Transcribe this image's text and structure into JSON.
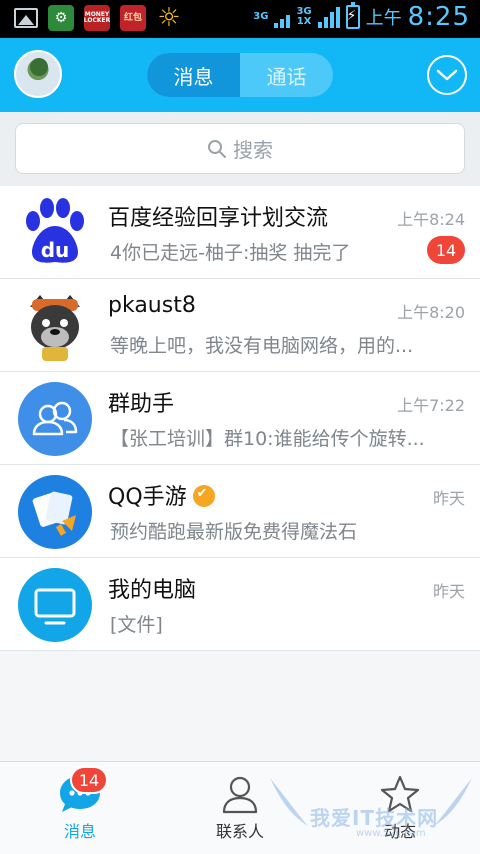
{
  "status_bar": {
    "notif_money": "MONEY LOCKER",
    "notif_hongbao": "红包",
    "net_top": "3G",
    "net_mid": "3G",
    "net_bottom": "1X",
    "ampm": "上午",
    "time": "8:25"
  },
  "header": {
    "tabs": [
      {
        "label": "消息",
        "active": true
      },
      {
        "label": "通话",
        "active": false
      }
    ],
    "dropdown_icon": "chevron-down-circle-icon"
  },
  "search": {
    "placeholder": "搜索"
  },
  "conversations": [
    {
      "title": "百度经验回享计划交流",
      "time": "上午8:24",
      "preview": "4你已走远-柚子:抽奖 抽完了",
      "unread": "14"
    },
    {
      "title": "pkaust8",
      "time": "上午8:20",
      "preview": "等晚上吧，我没有电脑网络，用的..."
    },
    {
      "title": "群助手",
      "time": "上午7:22",
      "preview": "【张工培训】群10:谁能给传个旋转..."
    },
    {
      "title": "QQ手游",
      "time": "昨天",
      "preview": "预约酷跑最新版免费得魔法石",
      "verified": true
    },
    {
      "title": "我的电脑",
      "time": "昨天",
      "preview": "[文件]"
    }
  ],
  "bottom_nav": {
    "items": [
      {
        "label": "消息",
        "icon": "chat-bubble-icon",
        "badge": "14",
        "active": true
      },
      {
        "label": "联系人",
        "icon": "contact-person-icon"
      },
      {
        "label": "动态",
        "icon": "star-icon"
      }
    ]
  },
  "watermark": {
    "text": "我爱IT技术网",
    "url": "www.52ij.com"
  },
  "colors": {
    "header": "#12b7f5",
    "tab_active": "#1296db",
    "badge": "#f0463a",
    "vip": "#f5a623"
  }
}
